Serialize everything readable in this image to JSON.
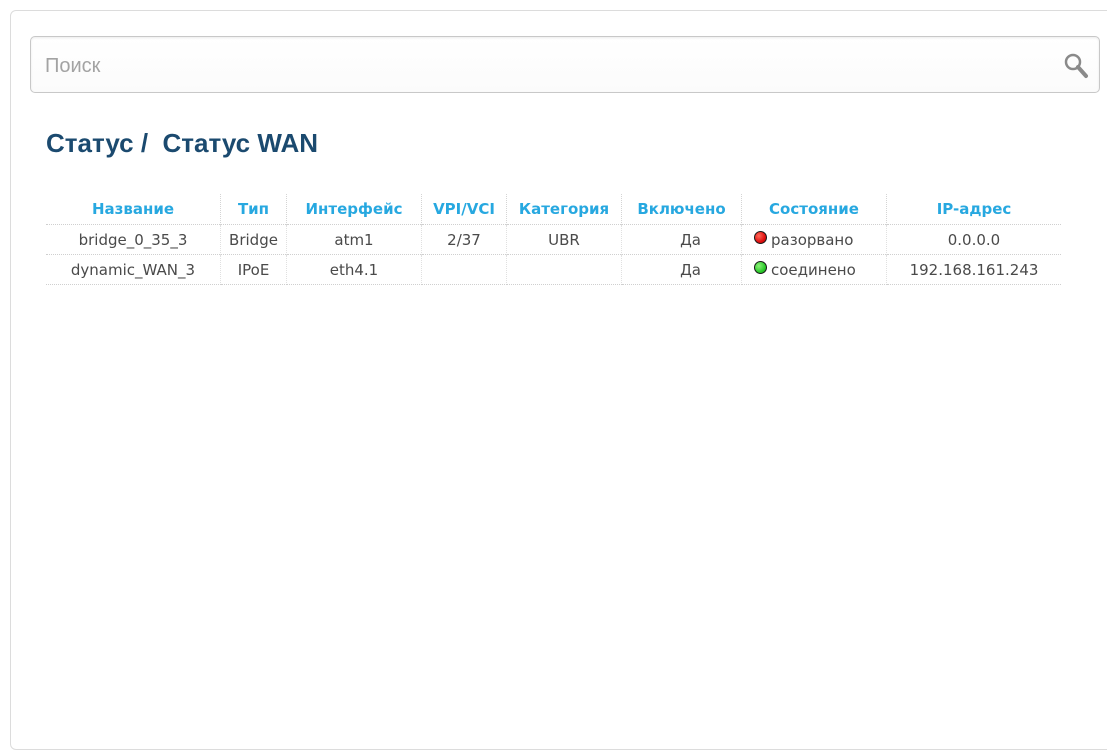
{
  "search": {
    "placeholder": "Поиск",
    "value": ""
  },
  "header": {
    "title": "Статус /  Статус WAN"
  },
  "table": {
    "columns": [
      "Название",
      "Тип",
      "Интерфейс",
      "VPI/VCI",
      "Категория",
      "Включено",
      "Состояние",
      "IP-адрес"
    ],
    "rows": [
      {
        "name": "bridge_0_35_3",
        "type": "Bridge",
        "interface": "atm1",
        "vpi_vci": "2/37",
        "category": "UBR",
        "enabled": "Да",
        "state": "разорвано",
        "state_color": "#e01010",
        "ip": "0.0.0.0"
      },
      {
        "name": "dynamic_WAN_3",
        "type": "IPoE",
        "interface": "eth4.1",
        "vpi_vci": "",
        "category": "",
        "enabled": "Да",
        "state": "соединено",
        "state_color": "#2ccb2c",
        "ip": "192.168.161.243"
      }
    ]
  },
  "colors": {
    "title": "#1b4a6f",
    "header_accent": "#27a8e0"
  }
}
